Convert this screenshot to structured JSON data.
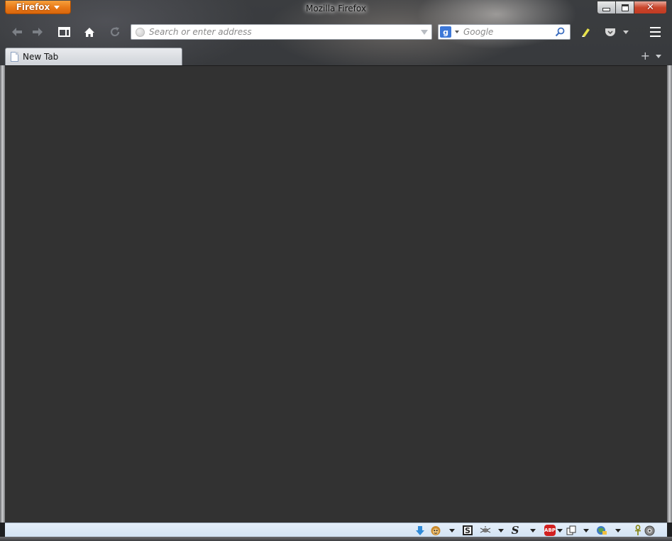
{
  "window": {
    "title": "Mozilla Firefox",
    "app_menu_label": "Firefox",
    "close_glyph": "✕"
  },
  "navbar": {
    "back_icon": "back-arrow-icon",
    "forward_icon": "forward-arrow-icon",
    "home_icon": "home-icon",
    "reload_icon": "reload-icon",
    "url_placeholder": "Search or enter address",
    "url_value": "",
    "search_engine_letter": "g",
    "search_placeholder": "Google",
    "search_value": ""
  },
  "tabs": [
    {
      "label": "New Tab",
      "active": true
    }
  ],
  "tabstrip": {
    "new_tab_symbol": "+"
  },
  "addon_bar": {
    "icons": [
      "download-arrow-icon",
      "greasemonkey-icon",
      "scrapbook-icon",
      "bug-icon",
      "stylish-icon",
      "adblock-plus-icon",
      "tab-tools-icon",
      "web-developer-icon",
      "ankh-icon",
      "robot-icon"
    ],
    "adblock_text": "ABP",
    "scrapbook_letter": "S",
    "stylish_letter": "S"
  },
  "colors": {
    "firefox_button": "#e87817",
    "content_background": "#323232",
    "addon_bar": "#d9e6f5",
    "download_arrow": "#2f8ad8",
    "adblock_red": "#d22020"
  }
}
